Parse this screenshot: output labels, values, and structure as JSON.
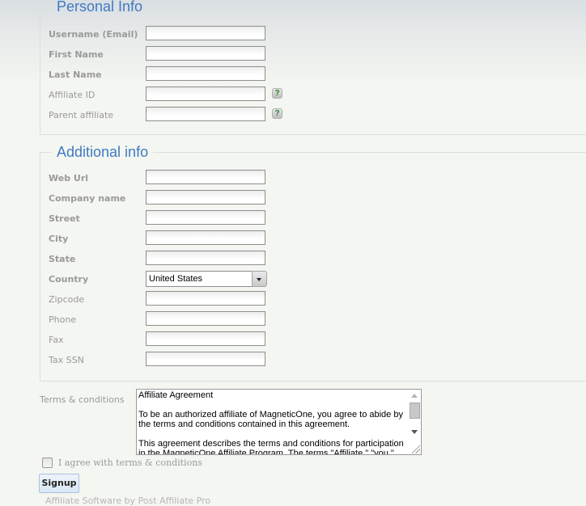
{
  "personal_info": {
    "legend": "Personal Info",
    "fields": [
      {
        "label": "Username (Email)",
        "value": "",
        "required": true,
        "help": false
      },
      {
        "label": "First Name",
        "value": "",
        "required": true,
        "help": false
      },
      {
        "label": "Last Name",
        "value": "",
        "required": true,
        "help": false
      },
      {
        "label": "Affiliate ID",
        "value": "",
        "required": false,
        "help": true
      },
      {
        "label": "Parent affiliate",
        "value": "",
        "required": false,
        "help": true
      }
    ],
    "help_icon_glyph": "?"
  },
  "additional_info": {
    "legend": "Additional info",
    "fields": [
      {
        "label": "Web Url",
        "value": "",
        "required": true
      },
      {
        "label": "Company name",
        "value": "",
        "required": true
      },
      {
        "label": "Street",
        "value": "",
        "required": true
      },
      {
        "label": "City",
        "value": "",
        "required": true
      },
      {
        "label": "State",
        "value": "",
        "required": true
      },
      {
        "label": "Country",
        "value": "United States",
        "required": true,
        "type": "select"
      },
      {
        "label": "Zipcode",
        "value": "",
        "required": false
      },
      {
        "label": "Phone",
        "value": "",
        "required": false
      },
      {
        "label": "Fax",
        "value": "",
        "required": false
      },
      {
        "label": "Tax SSN",
        "value": "",
        "required": false
      }
    ]
  },
  "terms": {
    "label": "Terms & conditions",
    "text": "Affiliate Agreement\n\nTo be an authorized affiliate of MagneticOne, you agree to abide by the terms and conditions contained in this agreement.\n\nThis agreement describes the terms and conditions for participation in the MagneticOne Affiliate Program. The terms \"Affiliate,\" \"you,\" and",
    "agree_label": "I agree with terms & conditions",
    "agree_checked": false
  },
  "signup_button": "Signup",
  "footer": "Affiliate Software by Post Affiliate Pro",
  "colors": {
    "legend": "#3f7ac3",
    "label": "#9a9a9a",
    "help_icon": "#1f8a1f"
  }
}
